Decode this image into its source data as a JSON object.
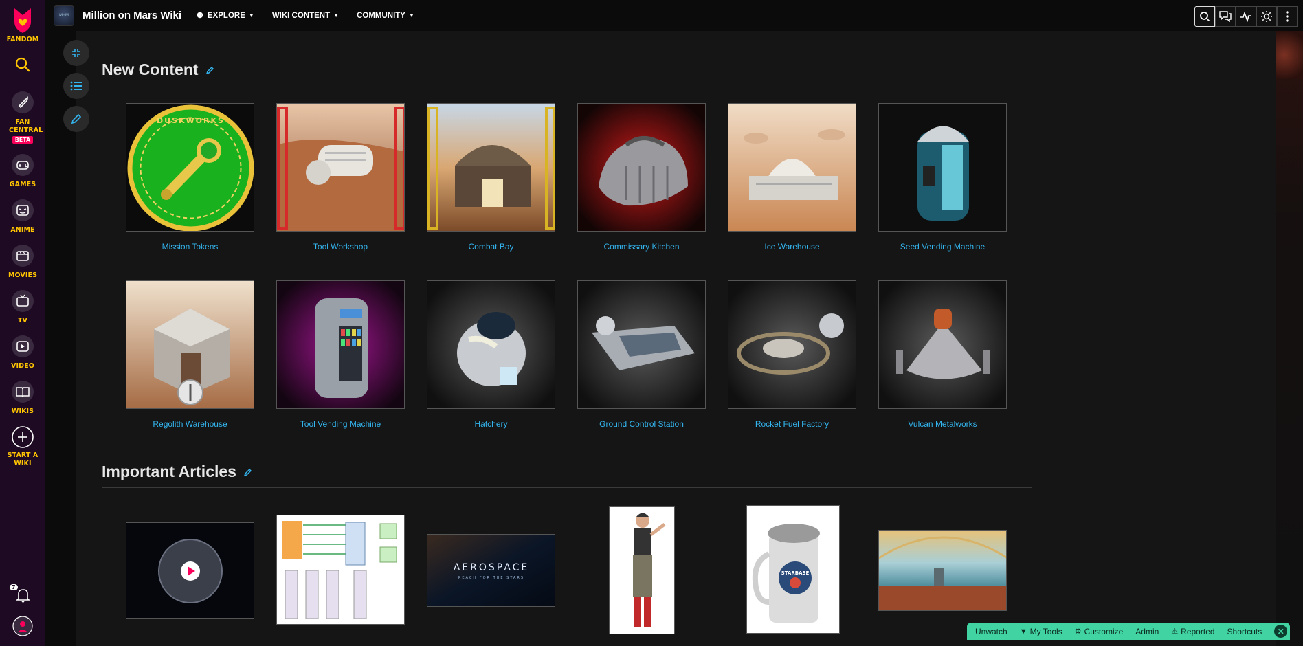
{
  "global_nav": {
    "brand": "FANDOM",
    "items": [
      {
        "label": "FAN CENTRAL",
        "badge": "BETA"
      },
      {
        "label": "GAMES"
      },
      {
        "label": "ANIME"
      },
      {
        "label": "MOVIES"
      },
      {
        "label": "TV"
      },
      {
        "label": "VIDEO"
      },
      {
        "label": "WIKIS"
      },
      {
        "label": "START A WIKI"
      }
    ],
    "notifications_count": "7"
  },
  "header": {
    "wiki_name": "Million on Mars Wiki",
    "nav": [
      {
        "label": "EXPLORE"
      },
      {
        "label": "WIKI CONTENT"
      },
      {
        "label": "COMMUNITY"
      }
    ]
  },
  "new_content": {
    "title": "New Content",
    "tiles": [
      {
        "label": "Mission Tokens",
        "coin_text": "DUSKWORKS"
      },
      {
        "label": "Tool Workshop"
      },
      {
        "label": "Combat Bay"
      },
      {
        "label": "Commissary Kitchen"
      },
      {
        "label": "Ice Warehouse"
      },
      {
        "label": "Seed Vending Machine"
      },
      {
        "label": "Regolith Warehouse"
      },
      {
        "label": "Tool Vending Machine"
      },
      {
        "label": "Hatchery"
      },
      {
        "label": "Ground Control Station"
      },
      {
        "label": "Rocket Fuel Factory"
      },
      {
        "label": "Vulcan Metalworks"
      }
    ]
  },
  "important_articles": {
    "title": "Important Articles",
    "items": [
      {
        "name": "million-on-mars-video"
      },
      {
        "name": "flow-diagram"
      },
      {
        "name": "aerospace-banner",
        "title": "AEROSPACE",
        "subtitle": "REACH FOR THE STARS"
      },
      {
        "name": "character-figure"
      },
      {
        "name": "starbase-mug",
        "text": "STARBASE"
      },
      {
        "name": "mars-dome-landscape"
      }
    ]
  },
  "admin_bar": {
    "items": [
      "Unwatch",
      "My Tools",
      "Customize",
      "Admin",
      "Reported",
      "Shortcuts"
    ]
  },
  "colors": {
    "link": "#33b5ef",
    "fandom_yellow": "#ffc500",
    "fandom_pink": "#fa005a",
    "admin_bar": "#41d3a1",
    "global_nav_bg": "#1f0a24"
  }
}
